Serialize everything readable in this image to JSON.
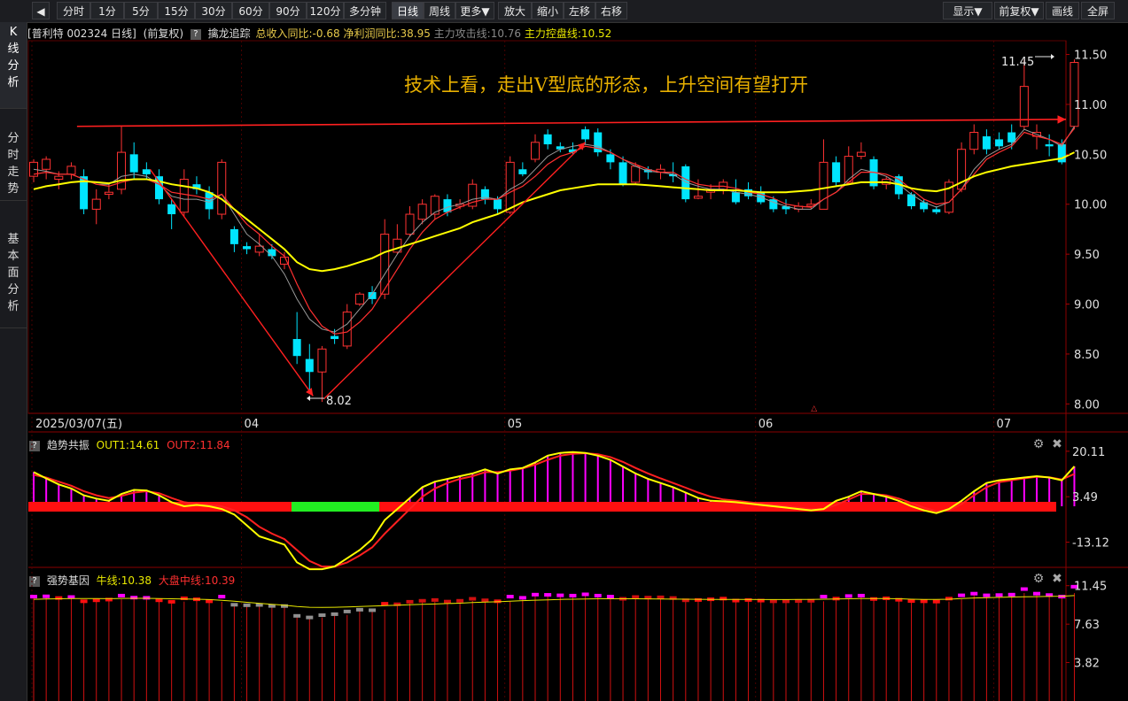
{
  "toolbar": {
    "back_icon": "back-arrow-icon",
    "tabs": [
      "分时",
      "1分",
      "5分",
      "15分",
      "30分",
      "60分",
      "90分",
      "120分",
      "多分钟",
      "日线",
      "周线",
      "更多▼",
      "放大",
      "缩小",
      "左移",
      "右移"
    ],
    "active_tab": "日线",
    "right_buttons": [
      "显示▼",
      "前复权▼",
      "画线",
      "全屏"
    ]
  },
  "left_nav": {
    "items": [
      {
        "label": "K\n线\n分\n析",
        "active": true
      },
      {
        "label": "分\n时\n走\n势",
        "active": false
      },
      {
        "label": "基\n本\n面\n分\n析",
        "active": false
      }
    ]
  },
  "info_bar": {
    "stock": "[普利特 002324 日线]",
    "adjust": "(前复权)",
    "help": "?",
    "indicator": "擒龙追踪",
    "revenue_yoy": "总收入同比:-0.68",
    "profit_yoy": "净利润同比:38.95",
    "attack_line": "主力攻击线:10.76",
    "control_line": "主力控盘线:10.52"
  },
  "annotation": "技术上看，走出V型底的形态，上升空间有望打开",
  "price_axis": [
    "11.50",
    "11.00",
    "10.50",
    "10.00",
    "9.50",
    "9.00",
    "8.50",
    "8.00"
  ],
  "high_label": "11.45",
  "low_label": "8.02",
  "date_labels": [
    "2025/03/07(五)",
    "04",
    "05",
    "06",
    "07"
  ],
  "panel2": {
    "name": "趋势共振",
    "help": "?",
    "out1": "OUT1:14.61",
    "out2": "OUT2:11.84",
    "axis": [
      "20.11",
      "3.49",
      "-13.12"
    ]
  },
  "panel3": {
    "name": "强势基因",
    "help": "?",
    "bull": "牛线:10.38",
    "market": "大盘中线:10.39",
    "axis": [
      "11.45",
      "7.63",
      "3.82"
    ]
  },
  "colors": {
    "up": "#ff3232",
    "down": "#00e5ff",
    "ma_yellow": "#ffff00",
    "ma_red": "#ff3030",
    "ma_gray": "#9a9a9a",
    "green_bar": "#22ee22",
    "magenta": "#ff00ff",
    "annotation": "#e8b000"
  },
  "chart_data": {
    "type": "candlestick",
    "candles": [
      {
        "o": 10.28,
        "c": 10.42,
        "h": 10.45,
        "l": 10.22
      },
      {
        "o": 10.35,
        "c": 10.45,
        "h": 10.48,
        "l": 10.25
      },
      {
        "o": 10.25,
        "c": 10.28,
        "h": 10.33,
        "l": 10.15
      },
      {
        "o": 10.3,
        "c": 10.38,
        "h": 10.42,
        "l": 10.25
      },
      {
        "o": 10.28,
        "c": 9.95,
        "h": 10.35,
        "l": 9.9
      },
      {
        "o": 9.95,
        "c": 10.05,
        "h": 10.15,
        "l": 9.8
      },
      {
        "o": 10.1,
        "c": 10.12,
        "h": 10.2,
        "l": 10.05
      },
      {
        "o": 10.15,
        "c": 10.52,
        "h": 10.78,
        "l": 10.1
      },
      {
        "o": 10.5,
        "c": 10.32,
        "h": 10.62,
        "l": 10.25
      },
      {
        "o": 10.35,
        "c": 10.3,
        "h": 10.42,
        "l": 10.25
      },
      {
        "o": 10.28,
        "c": 10.05,
        "h": 10.35,
        "l": 10.0
      },
      {
        "o": 10.0,
        "c": 9.9,
        "h": 10.05,
        "l": 9.75
      },
      {
        "o": 9.92,
        "c": 10.25,
        "h": 10.35,
        "l": 9.88
      },
      {
        "o": 10.2,
        "c": 10.15,
        "h": 10.28,
        "l": 10.1
      },
      {
        "o": 10.12,
        "c": 9.95,
        "h": 10.18,
        "l": 9.85
      },
      {
        "o": 9.9,
        "c": 10.42,
        "h": 10.45,
        "l": 9.85
      },
      {
        "o": 9.75,
        "c": 9.6,
        "h": 9.78,
        "l": 9.52
      },
      {
        "o": 9.58,
        "c": 9.55,
        "h": 9.62,
        "l": 9.5
      },
      {
        "o": 9.52,
        "c": 9.58,
        "h": 9.7,
        "l": 9.48
      },
      {
        "o": 9.55,
        "c": 9.48,
        "h": 9.6,
        "l": 9.45
      },
      {
        "o": 9.4,
        "c": 9.47,
        "h": 9.52,
        "l": 9.35
      },
      {
        "o": 8.65,
        "c": 8.48,
        "h": 8.92,
        "l": 8.4
      },
      {
        "o": 8.45,
        "c": 8.32,
        "h": 8.6,
        "l": 8.1
      },
      {
        "o": 8.32,
        "c": 8.55,
        "h": 8.58,
        "l": 8.02
      },
      {
        "o": 8.68,
        "c": 8.65,
        "h": 8.75,
        "l": 8.6
      },
      {
        "o": 8.58,
        "c": 8.92,
        "h": 9.0,
        "l": 8.55
      },
      {
        "o": 9.0,
        "c": 9.1,
        "h": 9.12,
        "l": 8.98
      },
      {
        "o": 9.12,
        "c": 9.05,
        "h": 9.18,
        "l": 9.0
      },
      {
        "o": 9.1,
        "c": 9.7,
        "h": 9.85,
        "l": 9.05
      },
      {
        "o": 9.52,
        "c": 9.65,
        "h": 9.8,
        "l": 9.5
      },
      {
        "o": 9.7,
        "c": 9.9,
        "h": 9.98,
        "l": 9.68
      },
      {
        "o": 9.85,
        "c": 10.0,
        "h": 10.05,
        "l": 9.8
      },
      {
        "o": 9.9,
        "c": 10.08,
        "h": 10.1,
        "l": 9.85
      },
      {
        "o": 10.05,
        "c": 9.92,
        "h": 10.1,
        "l": 9.88
      },
      {
        "o": 9.98,
        "c": 10.0,
        "h": 10.05,
        "l": 9.95
      },
      {
        "o": 9.98,
        "c": 10.2,
        "h": 10.25,
        "l": 9.95
      },
      {
        "o": 10.15,
        "c": 10.05,
        "h": 10.18,
        "l": 10.0
      },
      {
        "o": 10.05,
        "c": 9.95,
        "h": 10.08,
        "l": 9.9
      },
      {
        "o": 9.92,
        "c": 10.42,
        "h": 10.48,
        "l": 9.9
      },
      {
        "o": 10.35,
        "c": 10.3,
        "h": 10.42,
        "l": 10.28
      },
      {
        "o": 10.45,
        "c": 10.62,
        "h": 10.7,
        "l": 10.42
      },
      {
        "o": 10.7,
        "c": 10.6,
        "h": 10.75,
        "l": 10.55
      },
      {
        "o": 10.58,
        "c": 10.55,
        "h": 10.62,
        "l": 10.52
      },
      {
        "o": 10.55,
        "c": 10.52,
        "h": 10.62,
        "l": 10.5
      },
      {
        "o": 10.75,
        "c": 10.65,
        "h": 10.78,
        "l": 10.6
      },
      {
        "o": 10.72,
        "c": 10.52,
        "h": 10.76,
        "l": 10.48
      },
      {
        "o": 10.5,
        "c": 10.42,
        "h": 10.55,
        "l": 10.35
      },
      {
        "o": 10.42,
        "c": 10.2,
        "h": 10.48,
        "l": 10.18
      },
      {
        "o": 10.22,
        "c": 10.38,
        "h": 10.42,
        "l": 10.2
      },
      {
        "o": 10.35,
        "c": 10.32,
        "h": 10.38,
        "l": 10.25
      },
      {
        "o": 10.32,
        "c": 10.35,
        "h": 10.4,
        "l": 10.25
      },
      {
        "o": 10.3,
        "c": 10.28,
        "h": 10.42,
        "l": 10.22
      },
      {
        "o": 10.38,
        "c": 10.05,
        "h": 10.4,
        "l": 10.02
      },
      {
        "o": 10.06,
        "c": 10.08,
        "h": 10.25,
        "l": 10.05
      },
      {
        "o": 10.12,
        "c": 10.15,
        "h": 10.2,
        "l": 10.05
      },
      {
        "o": 10.15,
        "c": 10.22,
        "h": 10.25,
        "l": 10.1
      },
      {
        "o": 10.12,
        "c": 10.02,
        "h": 10.25,
        "l": 10.0
      },
      {
        "o": 10.15,
        "c": 10.08,
        "h": 10.22,
        "l": 10.05
      },
      {
        "o": 10.12,
        "c": 10.02,
        "h": 10.18,
        "l": 10.0
      },
      {
        "o": 10.05,
        "c": 9.95,
        "h": 10.08,
        "l": 9.92
      },
      {
        "o": 9.98,
        "c": 9.95,
        "h": 10.05,
        "l": 9.9
      },
      {
        "o": 9.95,
        "c": 9.98,
        "h": 10.02,
        "l": 9.92
      },
      {
        "o": 9.98,
        "c": 10.0,
        "h": 10.05,
        "l": 9.95
      },
      {
        "o": 9.95,
        "c": 10.42,
        "h": 10.65,
        "l": 9.95
      },
      {
        "o": 10.42,
        "c": 10.22,
        "h": 10.48,
        "l": 10.18
      },
      {
        "o": 10.22,
        "c": 10.48,
        "h": 10.58,
        "l": 10.2
      },
      {
        "o": 10.48,
        "c": 10.52,
        "h": 10.62,
        "l": 10.45
      },
      {
        "o": 10.45,
        "c": 10.18,
        "h": 10.48,
        "l": 10.15
      },
      {
        "o": 10.2,
        "c": 10.25,
        "h": 10.28,
        "l": 10.15
      },
      {
        "o": 10.28,
        "c": 10.1,
        "h": 10.3,
        "l": 10.05
      },
      {
        "o": 10.1,
        "c": 9.98,
        "h": 10.12,
        "l": 9.95
      },
      {
        "o": 10.02,
        "c": 9.95,
        "h": 10.05,
        "l": 9.92
      },
      {
        "o": 9.95,
        "c": 9.92,
        "h": 9.98,
        "l": 9.9
      },
      {
        "o": 9.92,
        "c": 10.22,
        "h": 10.25,
        "l": 9.9
      },
      {
        "o": 10.15,
        "c": 10.55,
        "h": 10.62,
        "l": 10.12
      },
      {
        "o": 10.55,
        "c": 10.72,
        "h": 10.8,
        "l": 10.5
      },
      {
        "o": 10.68,
        "c": 10.55,
        "h": 10.75,
        "l": 10.5
      },
      {
        "o": 10.65,
        "c": 10.58,
        "h": 10.72,
        "l": 10.55
      },
      {
        "o": 10.72,
        "c": 10.62,
        "h": 10.8,
        "l": 10.55
      },
      {
        "o": 10.78,
        "c": 11.18,
        "h": 11.45,
        "l": 10.75
      },
      {
        "o": 10.68,
        "c": 10.72,
        "h": 10.8,
        "l": 10.55
      },
      {
        "o": 10.6,
        "c": 10.58,
        "h": 10.7,
        "l": 10.48
      },
      {
        "o": 10.6,
        "c": 10.42,
        "h": 10.65,
        "l": 10.4
      },
      {
        "o": 10.78,
        "c": 11.42,
        "h": 11.45,
        "l": 10.75
      }
    ],
    "ylim": [
      7.95,
      11.62
    ],
    "ma_yellow": [
      10.15,
      10.18,
      10.2,
      10.22,
      10.23,
      10.22,
      10.21,
      10.24,
      10.25,
      10.25,
      10.23,
      10.2,
      10.18,
      10.16,
      10.12,
      10.05,
      9.95,
      9.85,
      9.75,
      9.65,
      9.55,
      9.42,
      9.35,
      9.33,
      9.35,
      9.38,
      9.42,
      9.46,
      9.52,
      9.56,
      9.6,
      9.64,
      9.68,
      9.72,
      9.76,
      9.82,
      9.86,
      9.9,
      9.96,
      10.02,
      10.06,
      10.1,
      10.14,
      10.16,
      10.18,
      10.2,
      10.2,
      10.2,
      10.2,
      10.19,
      10.18,
      10.17,
      10.16,
      10.15,
      10.14,
      10.14,
      10.14,
      10.13,
      10.12,
      10.12,
      10.12,
      10.13,
      10.14,
      10.16,
      10.18,
      10.2,
      10.22,
      10.22,
      10.22,
      10.2,
      10.16,
      10.14,
      10.13,
      10.16,
      10.22,
      10.28,
      10.32,
      10.35,
      10.38,
      10.4,
      10.42,
      10.44,
      10.46,
      10.52
    ],
    "ma_red": [
      10.3,
      10.32,
      10.3,
      10.3,
      10.25,
      10.2,
      10.18,
      10.22,
      10.25,
      10.25,
      10.2,
      10.12,
      10.1,
      10.08,
      10.05,
      10.1,
      9.95,
      9.8,
      9.7,
      9.58,
      9.48,
      9.2,
      8.95,
      8.78,
      8.7,
      8.72,
      8.82,
      8.95,
      9.15,
      9.35,
      9.55,
      9.72,
      9.85,
      9.92,
      9.97,
      10.02,
      10.05,
      10.05,
      10.12,
      10.18,
      10.28,
      10.4,
      10.48,
      10.52,
      10.58,
      10.56,
      10.52,
      10.45,
      10.4,
      10.35,
      10.32,
      10.32,
      10.25,
      10.2,
      10.18,
      10.18,
      10.16,
      10.12,
      10.1,
      10.06,
      10.0,
      9.98,
      9.97,
      10.05,
      10.12,
      10.22,
      10.32,
      10.32,
      10.3,
      10.25,
      10.15,
      10.05,
      10.0,
      10.02,
      10.15,
      10.3,
      10.45,
      10.52,
      10.58,
      10.72,
      10.68,
      10.65,
      10.6,
      10.76
    ],
    "ma_gray": [
      10.35,
      10.33,
      10.3,
      10.3,
      10.25,
      10.2,
      10.2,
      10.28,
      10.3,
      10.28,
      10.2,
      10.08,
      10.05,
      10.05,
      10.02,
      10.1,
      9.9,
      9.7,
      9.6,
      9.48,
      9.3,
      9.05,
      8.85,
      8.75,
      8.72,
      8.8,
      8.95,
      9.1,
      9.3,
      9.5,
      9.68,
      9.82,
      9.92,
      9.97,
      10.0,
      10.05,
      10.07,
      10.05,
      10.15,
      10.22,
      10.35,
      10.48,
      10.55,
      10.58,
      10.6,
      10.58,
      10.52,
      10.45,
      10.38,
      10.33,
      10.32,
      10.3,
      10.22,
      10.18,
      10.15,
      10.15,
      10.12,
      10.1,
      10.07,
      10.02,
      9.98,
      9.95,
      9.95,
      10.05,
      10.12,
      10.25,
      10.35,
      10.32,
      10.28,
      10.2,
      10.1,
      10.02,
      9.97,
      10.02,
      10.15,
      10.35,
      10.48,
      10.55,
      10.6,
      10.75,
      10.7,
      10.65,
      10.58,
      10.78
    ],
    "resistance": {
      "x0": 6,
      "y0": 10.78,
      "x1": 83,
      "y1": 10.85
    },
    "trend_down": {
      "from": [
        9,
        10.35
      ],
      "to": [
        22,
        8.08
      ]
    },
    "trend_up": {
      "from": [
        23,
        8.05
      ],
      "to": [
        44,
        10.62
      ]
    }
  },
  "osc_data": {
    "ylim": [
      -22,
      22
    ],
    "out1": [
      12.5,
      10.2,
      8.0,
      6.5,
      4.0,
      2.8,
      2.0,
      4.5,
      6.0,
      5.8,
      4.0,
      1.5,
      0.0,
      0.5,
      0.0,
      -1.0,
      -3.0,
      -7.0,
      -11.0,
      -12.5,
      -14.0,
      -20.5,
      -23.0,
      -23.0,
      -22.0,
      -19.0,
      -16.0,
      -12.0,
      -5.0,
      -1.0,
      3.0,
      7.0,
      9.0,
      10.0,
      11.0,
      12.0,
      13.5,
      12.0,
      13.5,
      14.0,
      16.0,
      18.5,
      19.5,
      19.8,
      19.5,
      18.5,
      17.0,
      14.5,
      12.0,
      10.0,
      8.5,
      7.0,
      5.0,
      3.0,
      2.0,
      1.8,
      1.5,
      1.0,
      0.5,
      0.0,
      -0.5,
      -1.0,
      -1.5,
      -1.0,
      2.0,
      3.5,
      5.5,
      4.5,
      3.5,
      2.0,
      0.0,
      -1.5,
      -2.5,
      -1.0,
      2.0,
      5.5,
      8.5,
      9.5,
      10.0,
      10.5,
      11.0,
      10.5,
      9.5,
      14.6
    ],
    "out2": [
      11.5,
      10.5,
      9.0,
      7.5,
      5.5,
      4.0,
      3.0,
      3.8,
      5.0,
      5.5,
      4.8,
      3.0,
      1.5,
      0.8,
      0.5,
      0.0,
      -1.5,
      -4.0,
      -7.5,
      -10.0,
      -12.0,
      -16.0,
      -20.0,
      -22.0,
      -22.0,
      -20.5,
      -18.0,
      -15.0,
      -10.0,
      -5.5,
      -1.0,
      3.5,
      6.5,
      8.5,
      10.0,
      11.0,
      12.5,
      12.5,
      13.0,
      13.8,
      15.2,
      17.0,
      18.5,
      19.2,
      19.4,
      19.0,
      18.0,
      16.2,
      14.0,
      12.0,
      10.2,
      8.5,
      6.8,
      5.0,
      3.5,
      2.5,
      2.0,
      1.5,
      1.0,
      0.5,
      0.0,
      -0.5,
      -1.0,
      -1.0,
      0.5,
      2.5,
      4.5,
      4.5,
      4.0,
      2.8,
      1.2,
      -0.5,
      -1.8,
      -1.5,
      0.8,
      4.0,
      7.0,
      8.8,
      9.5,
      10.2,
      10.8,
      10.6,
      9.8,
      11.84
    ],
    "base_green_from": 20,
    "base_green_to": 27
  },
  "gene_data": {
    "ylim": [
      0,
      11.6
    ]
  }
}
